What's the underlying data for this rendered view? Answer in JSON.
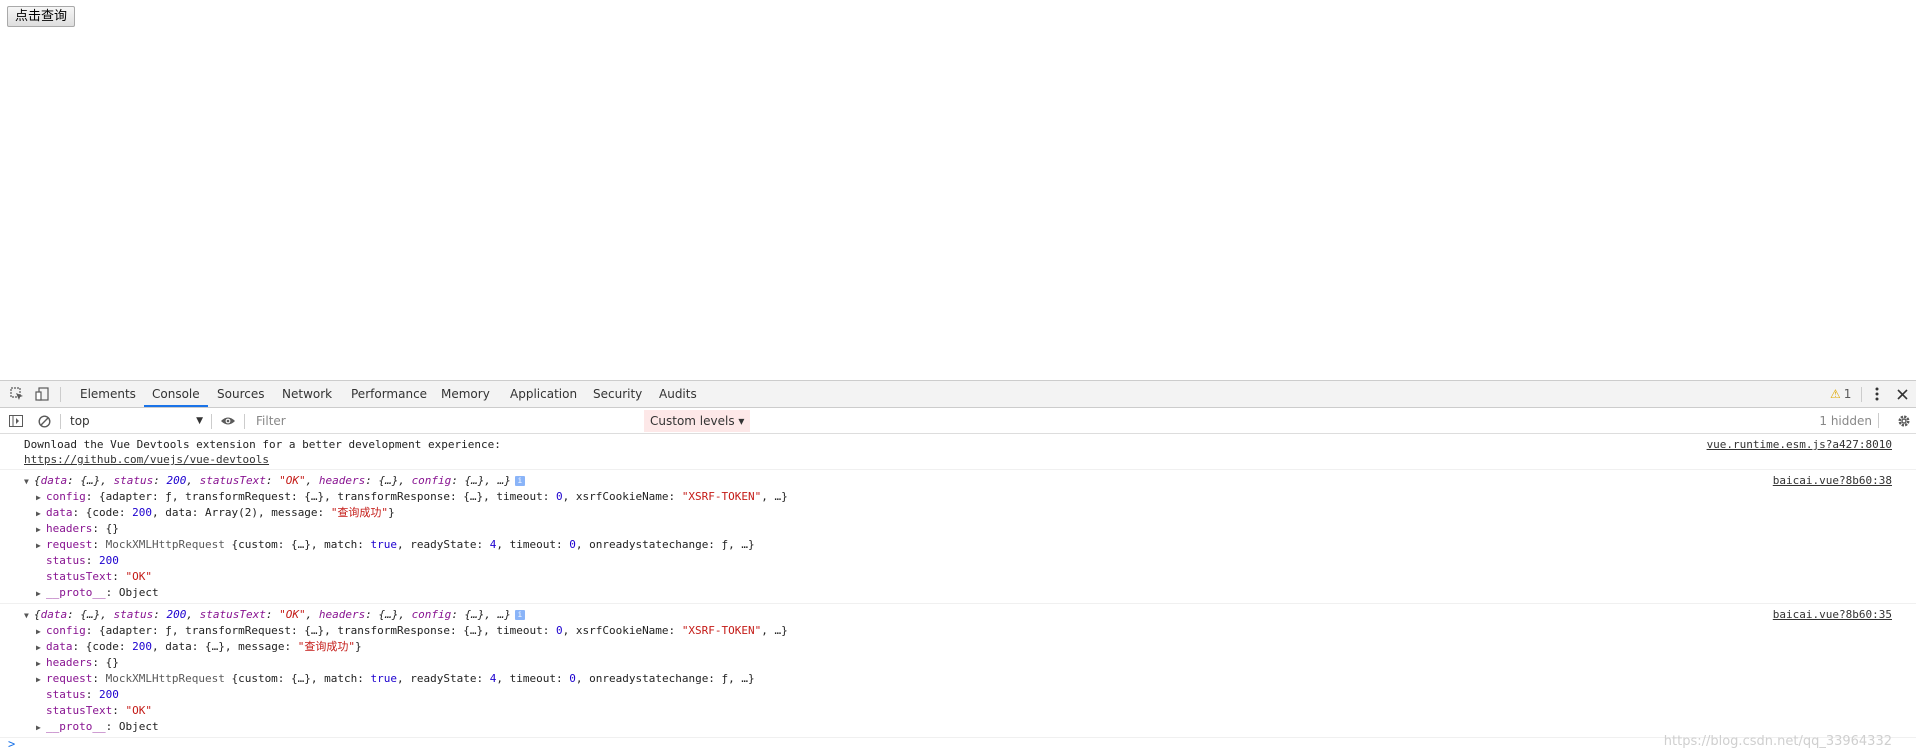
{
  "page": {
    "button_label": "点击查询"
  },
  "devtools": {
    "tabs": [
      "Elements",
      "Console",
      "Sources",
      "Network",
      "Performance",
      "Memory",
      "Application",
      "Security",
      "Audits"
    ],
    "active_tab": "Console",
    "warnings": "1",
    "context": "top",
    "filter_placeholder": "Filter",
    "levels_label": "Custom levels ▾",
    "hidden_label": "1 hidden",
    "icons": [
      "inspect-icon",
      "device-icon",
      "sidebar-icon",
      "clear-icon",
      "eye-icon",
      "kebab-icon",
      "close-icon",
      "gear-icon",
      "warning-icon",
      "info-icon"
    ]
  },
  "console": {
    "msg1": {
      "line1": "Download the Vue Devtools extension for a better development experience:",
      "link": "https://github.com/vuejs/vue-devtools",
      "source": "vue.runtime.esm.js?a427:8010"
    },
    "msg2": {
      "source": "baicai.vue?8b60:38",
      "data_detail": "Array(2)"
    },
    "msg3": {
      "source": "baicai.vue?8b60:35",
      "data_detail": "{…}"
    },
    "shared": {
      "summary_data": "data",
      "summary_status": "status",
      "summary_status_val": "200",
      "summary_statusText": "statusText",
      "summary_statusText_val": "\"OK\"",
      "summary_headers": "headers",
      "summary_config": "config",
      "config_key": "config",
      "config_val_a": "{adapter: ƒ, transformRequest: {…}, transformResponse: {…}, timeout: ",
      "config_timeout": "0",
      "config_val_b": ", xsrfCookieName: ",
      "config_xsrf": "\"XSRF-TOKEN\"",
      "config_val_c": ", …}",
      "data_key": "data",
      "data_val_a": "{code: ",
      "data_code": "200",
      "data_val_b": ", data: ",
      "data_val_c": ", message: ",
      "data_message": "\"查询成功\"",
      "data_val_d": "}",
      "headers_key": "headers",
      "headers_val": "{}",
      "request_key": "request",
      "request_cls": "MockXMLHttpRequest",
      "request_val_a": " {custom: {…}, match: ",
      "request_match": "true",
      "request_val_b": ", readyState: ",
      "request_ready": "4",
      "request_val_c": ", timeout: ",
      "request_timeout": "0",
      "request_val_d": ", onreadystatechange: ƒ, …}",
      "status_key": "status",
      "status_val": "200",
      "statusText_key": "statusText",
      "statusText_val": "\"OK\"",
      "proto_key": "__proto__",
      "proto_val": "Object"
    }
  },
  "watermark": "https://blog.csdn.net/qq_33964332"
}
